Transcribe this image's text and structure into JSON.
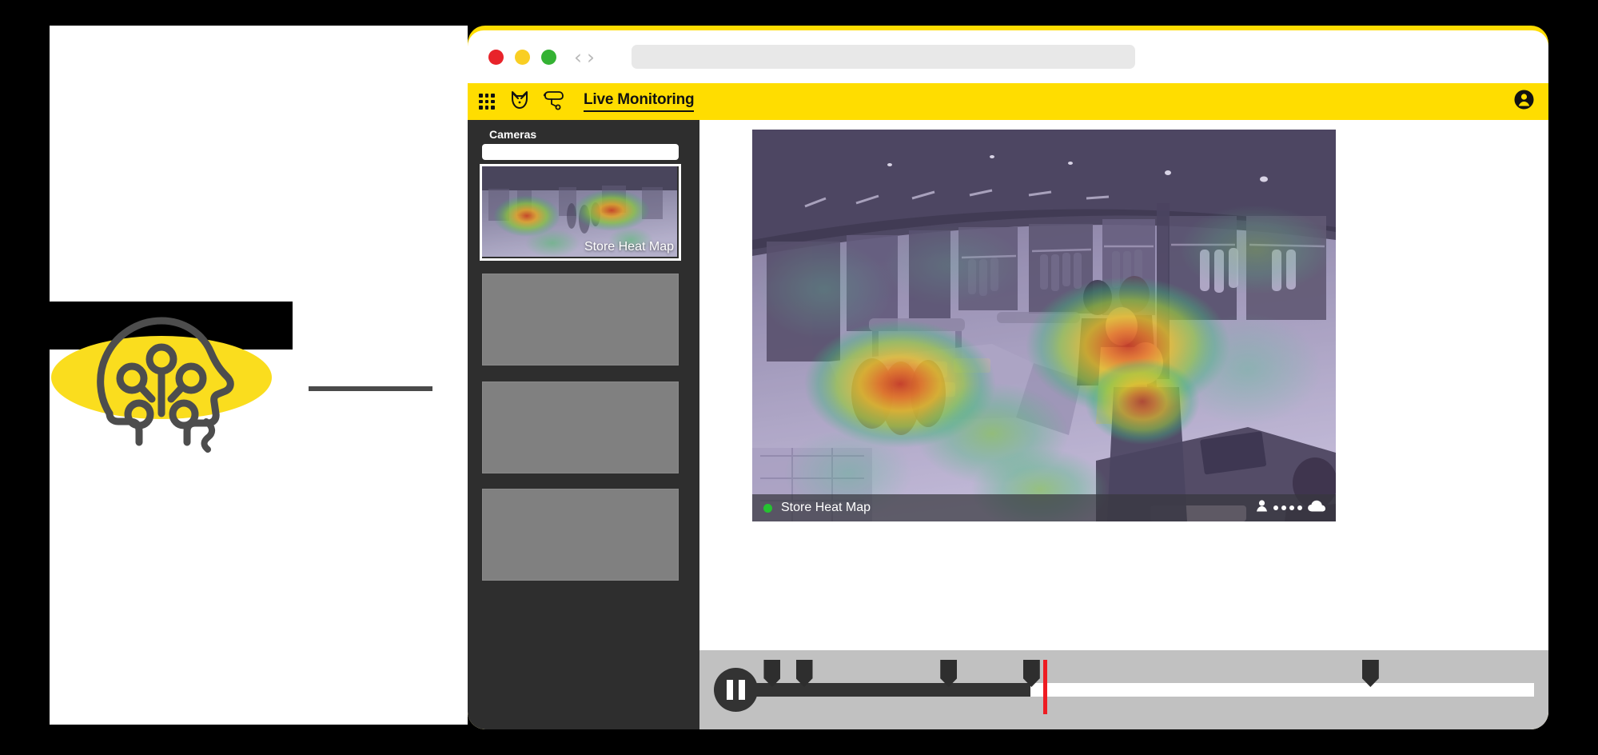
{
  "brand": {
    "logo_name": "ai-head-circuit-logo",
    "accent_color": "#FFDD00",
    "logo_line_color": "#4a4a4a"
  },
  "browser": {
    "traffic_lights": [
      "close",
      "minimize",
      "zoom"
    ],
    "nav_back_glyph": "‹",
    "nav_forward_glyph": "›",
    "address_value": "",
    "address_placeholder": ""
  },
  "appnav": {
    "title": "Live Monitoring",
    "icons": [
      "apps-grid-icon",
      "owl-logo-icon",
      "cctv-camera-icon"
    ],
    "account_icon": "account-avatar-icon"
  },
  "sidebar": {
    "title": "Cameras",
    "search_value": "",
    "search_placeholder": "",
    "cameras": [
      {
        "label": "Store Heat Map",
        "selected": true,
        "has_preview": true
      },
      {
        "label": "",
        "selected": false,
        "has_preview": false
      },
      {
        "label": "",
        "selected": false,
        "has_preview": false
      },
      {
        "label": "",
        "selected": false,
        "has_preview": false
      }
    ]
  },
  "player": {
    "stream_label": "Store Heat Map",
    "status": "live",
    "status_color": "#25C231",
    "status_icons": [
      "person-icon",
      "signal-dots-icon",
      "cloud-icon"
    ],
    "signal_dot_count": 4
  },
  "timeline": {
    "play_state": "paused",
    "pause_label": "Pause",
    "progress_percent": 35.5,
    "playhead_percent": 37.2,
    "playhead_color": "#EE1C22",
    "event_markers_percent": [
      2.4,
      6.5,
      25.0,
      35.6,
      79.0
    ]
  }
}
